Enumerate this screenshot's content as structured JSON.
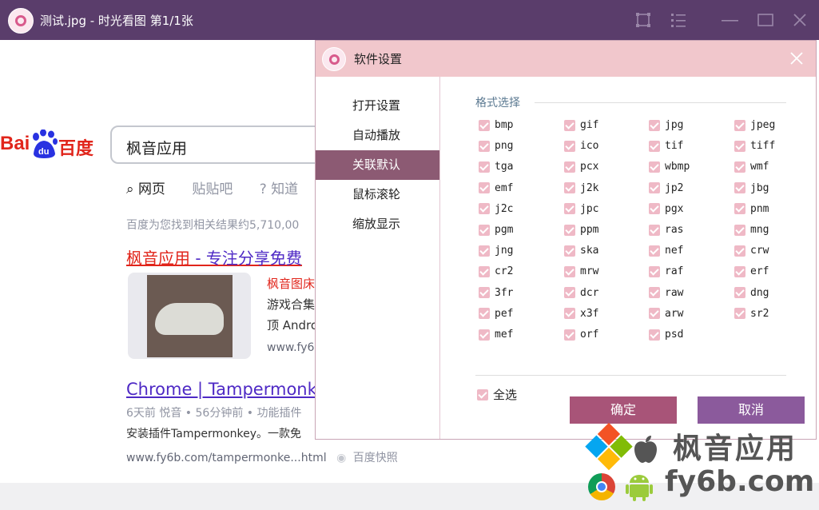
{
  "window": {
    "title": "测试.jpg - 时光看图 第1/1张"
  },
  "background_page": {
    "logo_latin": "Bai",
    "logo_du": "du",
    "logo_cn": "百度",
    "search_query": "枫音应用",
    "tabs": [
      "网页",
      "贴贴吧",
      "知道"
    ],
    "result_count": "百度为您找到相关结果约5,710,00",
    "result1_title_highlight": "枫音应用",
    "result1_title_rest": " - 专注分享免费",
    "result1_snippets": [
      "枫音图床",
      "游戏合集",
      "顶 Andro"
    ],
    "result1_url": "www.fy6",
    "result2_title": "Chrome | Tampermonke",
    "result2_meta": "6天前 悦音 • 56分钟前 • 功能插件",
    "result2_line": "安装插件Tampermonkey。一款免",
    "result2_url": "www.fy6b.com/tampermonke...html",
    "result2_snapshot": "百度快照"
  },
  "dialog": {
    "title": "软件设置",
    "menu": [
      {
        "label": "打开设置",
        "active": false
      },
      {
        "label": "自动播放",
        "active": false
      },
      {
        "label": "关联默认",
        "active": true
      },
      {
        "label": "鼠标滚轮",
        "active": false
      },
      {
        "label": "缩放显示",
        "active": false
      }
    ],
    "group_title": "格式选择",
    "formats": [
      [
        "bmp",
        "gif",
        "jpg",
        "jpeg"
      ],
      [
        "png",
        "ico",
        "tif",
        "tiff"
      ],
      [
        "tga",
        "pcx",
        "wbmp",
        "wmf"
      ],
      [
        "emf",
        "j2k",
        "jp2",
        "jbg"
      ],
      [
        "j2c",
        "jpc",
        "pgx",
        "pnm"
      ],
      [
        "pgm",
        "ppm",
        "ras",
        "mng"
      ],
      [
        "jng",
        "ska",
        "nef",
        "crw"
      ],
      [
        "cr2",
        "mrw",
        "raf",
        "erf"
      ],
      [
        "3fr",
        "dcr",
        "raw",
        "dng"
      ],
      [
        "pef",
        "x3f",
        "arw",
        "sr2"
      ],
      [
        "mef",
        "orf",
        "psd"
      ]
    ],
    "select_all_label": "全选",
    "ok_label": "确定",
    "cancel_label": "取消"
  },
  "watermark": {
    "line1": "枫音应用",
    "line2": "fy6b.com"
  },
  "colors": {
    "titlebar": "#5a3d6b",
    "dialog_header": "#f1c7cc",
    "menu_active": "#8c5a73",
    "checkbox": "#efb9c6",
    "ok_button": "#a85478",
    "cancel_button": "#8b5a9c"
  }
}
